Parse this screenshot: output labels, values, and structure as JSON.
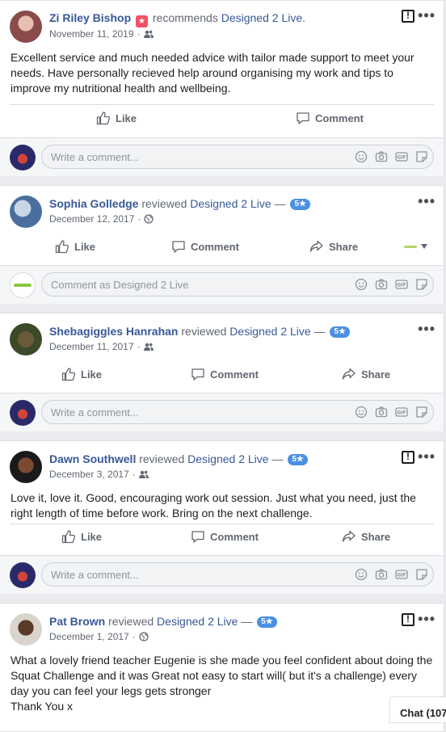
{
  "posts": [
    {
      "author": "Zi Riley Bishop",
      "verb": "recommends",
      "page": "Designed 2 Live",
      "punct": ".",
      "date": "November 11, 2019",
      "audience": "friends-icon",
      "text": "Excellent service and much needed advice with tailor made support to meet your needs. Have personally recieved help around organising my work and tips to improve my nutritional health and wellbeing.",
      "actions": [
        "Like",
        "Comment"
      ],
      "comment_placeholder": "Write a comment..."
    },
    {
      "author": "Sophia Golledge",
      "verb": "reviewed",
      "page": "Designed 2 Live",
      "dash": "—",
      "rating": "5★",
      "date": "December 12, 2017",
      "audience": "globe-icon",
      "actions": [
        "Like",
        "Comment",
        "Share"
      ],
      "comment_placeholder": "Comment as Designed 2 Live"
    },
    {
      "author": "Shebagiggles Hanrahan",
      "verb": "reviewed",
      "page": "Designed 2 Live",
      "dash": "—",
      "rating": "5★",
      "date": "December 11, 2017",
      "audience": "friends-icon",
      "actions": [
        "Like",
        "Comment",
        "Share"
      ],
      "comment_placeholder": "Write a comment..."
    },
    {
      "author": "Dawn Southwell",
      "verb": "reviewed",
      "page": "Designed 2 Live",
      "dash": "—",
      "rating": "5★",
      "date": "December 3, 2017",
      "audience": "friends-icon",
      "text": "Love it, love it. Good, encouraging work out session. Just what you need, just the right length of time before work. Bring on the next challenge.",
      "actions": [
        "Like",
        "Comment",
        "Share"
      ],
      "comment_placeholder": "Write a comment..."
    },
    {
      "author": "Pat Brown",
      "verb": "reviewed",
      "page": "Designed 2 Live",
      "dash": "—",
      "rating": "5★",
      "date": "December 1, 2017",
      "audience": "globe-icon",
      "text_lines": [
        "What a lovely friend teacher Eugenie is she made you feel confident about doing the Squat Challenge and it was Great not easy to start will( but it's a challenge) every day you can feel your legs gets stronger",
        "Thank You x"
      ]
    }
  ],
  "more_glyph": "•••",
  "chat_label": "Chat (107",
  "colors": {
    "link": "#385898",
    "badge": "#4a90e2",
    "bg": "#e9ebee"
  }
}
